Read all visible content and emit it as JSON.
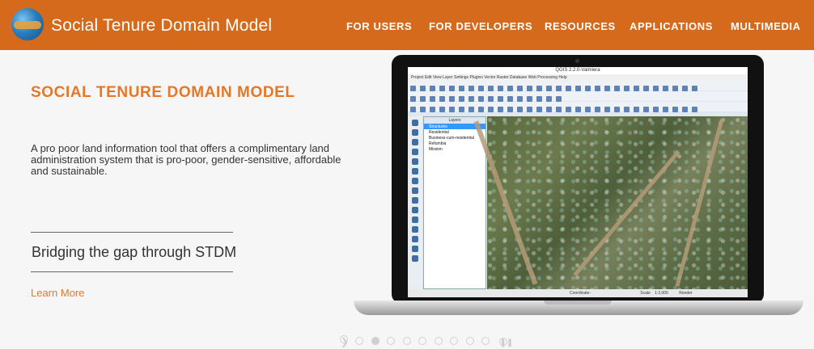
{
  "header": {
    "brand": "Social Tenure Domain Model",
    "menu": [
      "FOR USERS",
      "FOR DEVELOPERS",
      "RESOURCES",
      "APPLICATIONS",
      "MULTIMEDIA"
    ],
    "colors": {
      "bar": "#d56a1c",
      "text": "#ffffff"
    },
    "logo_icon": "globe-logo-icon"
  },
  "hero": {
    "title": "SOCIAL TENURE DOMAIN MODEL",
    "description": "A pro poor land information tool that offers a complimentary land administration system that is pro-poor, gender-sensitive, affordable and sustainable.",
    "tagline": "Bridging the gap through STDM",
    "link": "Learn More",
    "accent": "#e3782b"
  },
  "screenshot": {
    "window_title": "QGIS 2.2.0-Valmiera",
    "menu": "Project  Edit  View  Layer  Settings  Plugins  Vector  Raster  Database  Web  Processing  Help",
    "layers_title": "Layers",
    "layers": [
      "Structures",
      "Residential",
      "Business-cum-residential",
      "Refumbia",
      "Mission"
    ],
    "status_label": "Coordinate:",
    "scale_label": "Scale",
    "scale_value": "1:2,000",
    "render_label": "Render"
  },
  "carousel": {
    "slides": 10,
    "active_index": 1,
    "icons": [
      "prev-arrow-icon",
      "pause-icon"
    ]
  }
}
